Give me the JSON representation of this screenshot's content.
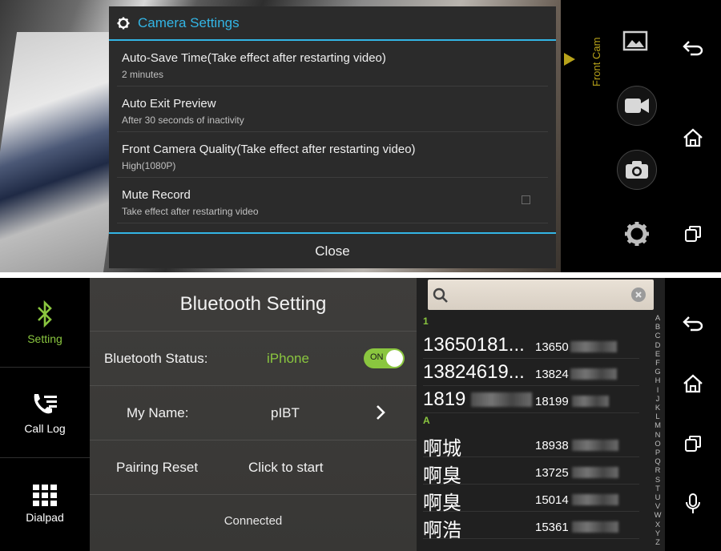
{
  "camera": {
    "dialog_title": "Camera Settings",
    "settings": [
      {
        "title": "Auto-Save Time(Take effect after restarting video)",
        "subtitle": "2 minutes"
      },
      {
        "title": "Auto Exit Preview",
        "subtitle": "After 30 seconds of inactivity"
      },
      {
        "title": "Front Camera Quality(Take effect after restarting video)",
        "subtitle": "High(1080P)"
      },
      {
        "title": "Mute Record",
        "subtitle": "Take effect after restarting video",
        "checkbox": false
      }
    ],
    "close_label": "Close",
    "cam_tab_label": "Front Cam",
    "accent": "#33b5e5"
  },
  "bluetooth": {
    "sidebar": [
      {
        "label": "Setting",
        "icon": "bluetooth-icon",
        "active": true
      },
      {
        "label": "Call Log",
        "icon": "call-log-icon",
        "active": false
      },
      {
        "label": "Dialpad",
        "icon": "dialpad-icon",
        "active": false
      }
    ],
    "title": "Bluetooth Setting",
    "status_label": "Bluetooth Status:",
    "status_value": "iPhone",
    "toggle_label": "ON",
    "toggle_on": true,
    "name_label": "My Name:",
    "name_value": "pIBT",
    "pairing_label": "Pairing Reset",
    "pairing_action": "Click to start",
    "connection": "Connected",
    "accent": "#8ac63f"
  },
  "contacts": {
    "section_1": "1",
    "section_a": "A",
    "numeric_rows": [
      {
        "name": "13650181...",
        "number": "13650"
      },
      {
        "name": "13824619...",
        "number": "13824"
      },
      {
        "name": "1819",
        "number": "18199"
      }
    ],
    "alpha_rows": [
      {
        "name": "啊城",
        "number": "18938"
      },
      {
        "name": "啊臭",
        "number": "13725"
      },
      {
        "name": "啊臭",
        "number": "15014"
      },
      {
        "name": "啊浩",
        "number": "15361"
      }
    ],
    "index": [
      "A",
      "B",
      "C",
      "D",
      "E",
      "F",
      "G",
      "H",
      "I",
      "J",
      "K",
      "L",
      "M",
      "N",
      "O",
      "P",
      "Q",
      "R",
      "S",
      "T",
      "U",
      "V",
      "W",
      "X",
      "Y",
      "Z"
    ]
  }
}
